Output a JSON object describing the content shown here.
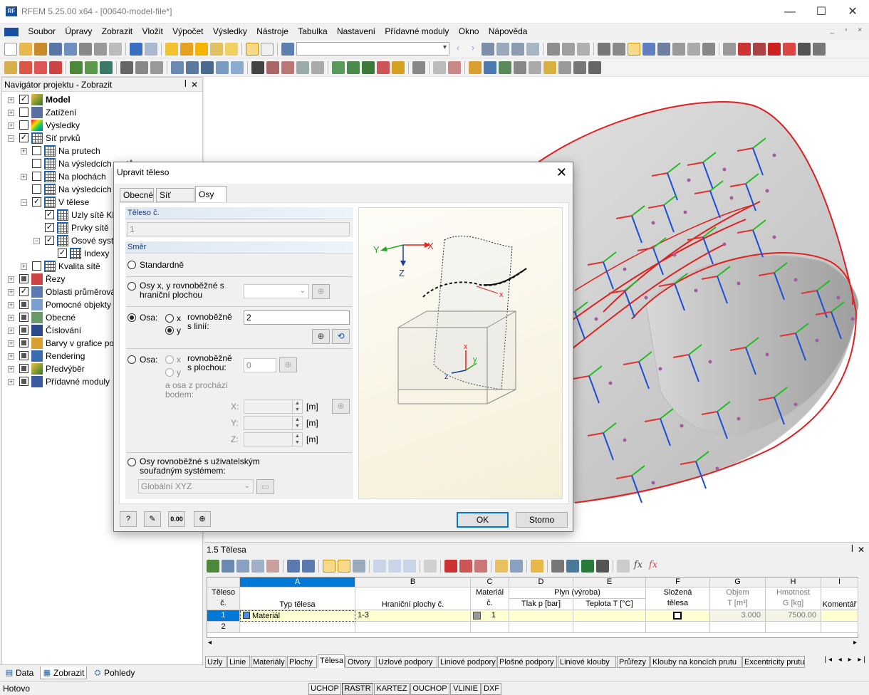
{
  "app": {
    "title": "RFEM 5.25.00 x64 - [00640-model-file*]",
    "logo_text": "RF"
  },
  "menu": {
    "items": [
      "Soubor",
      "Úpravy",
      "Zobrazit",
      "Vložit",
      "Výpočet",
      "Výsledky",
      "Nástroje",
      "Tabulka",
      "Nastavení",
      "Přídavné moduly",
      "Okno",
      "Nápověda"
    ]
  },
  "navigator": {
    "title": "Navigátor projektu - Zobrazit",
    "items": [
      {
        "label": "Model",
        "bold": true,
        "checked": "✓"
      },
      {
        "label": "Zatížení",
        "checked": ""
      },
      {
        "label": "Výsledky",
        "checked": ""
      },
      {
        "label": "Síť prvků",
        "checked": "✓"
      },
      {
        "label": "Na prutech",
        "checked": ""
      },
      {
        "label": "Na výsledcích prutů",
        "checked": ""
      },
      {
        "label": "Na plochách",
        "checked": ""
      },
      {
        "label": "Na výsledcích ploch",
        "checked": ""
      },
      {
        "label": "V tělese",
        "checked": "✓"
      },
      {
        "label": "Uzly sítě KP",
        "checked": "✓"
      },
      {
        "label": "Prvky sítě",
        "checked": "✓"
      },
      {
        "label": "Osové systémy",
        "checked": "✓"
      },
      {
        "label": "Indexy",
        "checked": "✓"
      },
      {
        "label": "Kvalita sítě",
        "checked": ""
      },
      {
        "label": "Řezy",
        "checked": "■"
      },
      {
        "label": "Oblasti průměrování",
        "checked": "✓"
      },
      {
        "label": "Pomocné objekty",
        "checked": "■"
      },
      {
        "label": "Obecné",
        "checked": "■"
      },
      {
        "label": "Číslování",
        "checked": "■"
      },
      {
        "label": "Barvy v grafice podle",
        "checked": "■"
      },
      {
        "label": "Rendering",
        "checked": "■"
      },
      {
        "label": "Předvýběr",
        "checked": "■"
      },
      {
        "label": "Přídavné moduly",
        "checked": "■"
      }
    ],
    "tabs": [
      "Data",
      "Zobrazit",
      "Pohledy"
    ]
  },
  "dialog": {
    "title": "Upravit těleso",
    "tabs": [
      "Obecné",
      "Síť prvků",
      "Osy"
    ],
    "active_tab": "Osy",
    "solid_no_label": "Těleso č.",
    "solid_no_value": "1",
    "direction_label": "Směr",
    "opt_standard": "Standardně",
    "opt_parallel_surface_line1": "Osy x, y rovnoběžné s",
    "opt_parallel_surface_line2": "hraniční plochou",
    "opt_axis_line_label": "Osa:",
    "opt_axis_x": "x",
    "opt_axis_y": "y",
    "parallel_line_text1": "rovnoběžně",
    "parallel_line_text2": "s linií:",
    "line_value": "2",
    "opt_axis_surface_label": "Osa:",
    "parallel_surface_text1": "rovnoběžně",
    "parallel_surface_text2": "s plochou:",
    "surface_value": "0",
    "through_point_line1": "a osa z prochází",
    "through_point_line2": "bodem:",
    "coord_x": "X:",
    "coord_y": "Y:",
    "coord_z": "Z:",
    "unit": "[m]",
    "opt_user_cs_line1": "Osy rovnoběžné s uživatelským",
    "opt_user_cs_line2": "souřadným systémem:",
    "user_cs_value": "Globální XYZ",
    "calc_button": "0.00",
    "ok": "OK",
    "cancel": "Storno",
    "diagram": {
      "y": "Y",
      "x": "X",
      "z": "Z",
      "lx": "x",
      "ly": "y",
      "lz": "z"
    }
  },
  "table": {
    "title": "1.5 Tělesa",
    "col_letters": [
      "A",
      "B",
      "C",
      "D",
      "E",
      "F",
      "G",
      "H",
      "I"
    ],
    "hdr_row_no": [
      "Těleso",
      "č."
    ],
    "hdr_type": "Typ tělesa",
    "hdr_boundary": "Hraniční plochy č.",
    "hdr_material": [
      "Materiál",
      "č."
    ],
    "hdr_gas": "Plyn (výroba)",
    "hdr_pressure": "Tlak p [bar]",
    "hdr_temp": "Teplota T [°C]",
    "hdr_composite": [
      "Složená",
      "tělesa"
    ],
    "hdr_volume": [
      "Objem",
      "T [m³]"
    ],
    "hdr_mass": [
      "Hmotnost",
      "G [kg]"
    ],
    "hdr_comment": "Komentář",
    "rows": [
      {
        "no": "1",
        "type": "Materiál",
        "boundary": "1-3",
        "material": "1",
        "volume": "3.000",
        "mass": "7500.00"
      },
      {
        "no": "2",
        "type": "",
        "boundary": "",
        "material": "",
        "volume": "",
        "mass": ""
      }
    ],
    "bottom_tabs": [
      "Uzly",
      "Linie",
      "Materiály",
      "Plochy",
      "Tělesa",
      "Otvory",
      "Uzlové podpory",
      "Liniové podpory",
      "Plošné podpory",
      "Liniové klouby",
      "Průřezy",
      "Klouby na koncích prutu",
      "Excentricity prutu"
    ],
    "active_bottom_tab": "Tělesa"
  },
  "status": {
    "text": "Hotovo",
    "buttons": [
      "UCHOP",
      "RASTR",
      "KARTEZ",
      "OUCHOP",
      "VLINIE",
      "DXF"
    ]
  },
  "colors": {
    "x_axis": "#e53030",
    "y_axis": "#22bb22",
    "z_axis": "#1a4fd6",
    "outline": "#e02020",
    "accent": "#0078d7"
  }
}
